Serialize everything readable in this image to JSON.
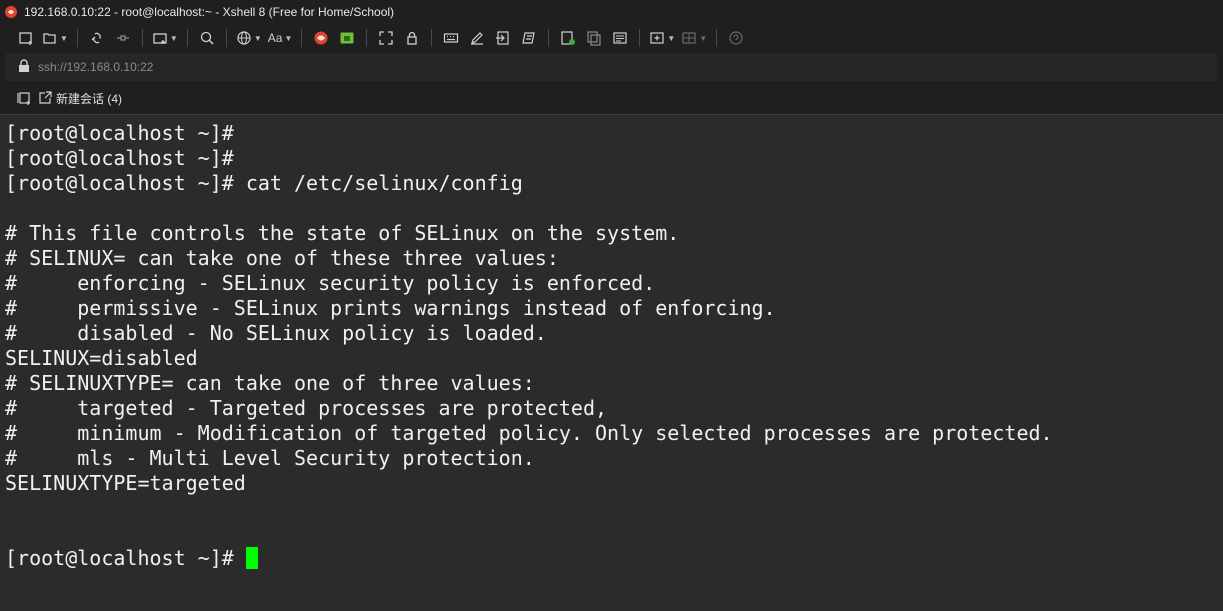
{
  "window": {
    "title": "192.168.0.10:22 - root@localhost:~ - Xshell 8 (Free for Home/School)"
  },
  "toolbar": {
    "font_label": "Aa",
    "icons": [
      "new-session-icon",
      "open-folder-icon",
      "connect-icon",
      "disconnect-icon",
      "new-tab-icon",
      "search-icon",
      "globe-icon",
      "font-icon",
      "xshell-icon",
      "xftp-icon",
      "fullscreen-icon",
      "lock-icon",
      "keyboard-icon",
      "pen-icon",
      "transfer-icon",
      "script-icon",
      "log-icon",
      "copy-icon",
      "compose-icon",
      "add-folder-icon",
      "layout-icon",
      "help-icon"
    ]
  },
  "address": {
    "value": "ssh://192.168.0.10:22"
  },
  "tabs": {
    "new_session_label": "新建会话 (4)"
  },
  "terminal": {
    "lines": [
      "[root@localhost ~]#",
      "[root@localhost ~]#",
      "[root@localhost ~]# cat /etc/selinux/config",
      "",
      "# This file controls the state of SELinux on the system.",
      "# SELINUX= can take one of these three values:",
      "#     enforcing - SELinux security policy is enforced.",
      "#     permissive - SELinux prints warnings instead of enforcing.",
      "#     disabled - No SELinux policy is loaded.",
      "SELINUX=disabled",
      "# SELINUXTYPE= can take one of three values:",
      "#     targeted - Targeted processes are protected,",
      "#     minimum - Modification of targeted policy. Only selected processes are protected.",
      "#     mls - Multi Level Security protection.",
      "SELINUXTYPE=targeted",
      "",
      ""
    ],
    "prompt": "[root@localhost ~]# ",
    "cursor_color": "#00ff00"
  },
  "colors": {
    "terminal_bg": "#2b2b2b",
    "terminal_fg": "#f0f0f0",
    "chrome_bg": "#1f1f1f"
  }
}
